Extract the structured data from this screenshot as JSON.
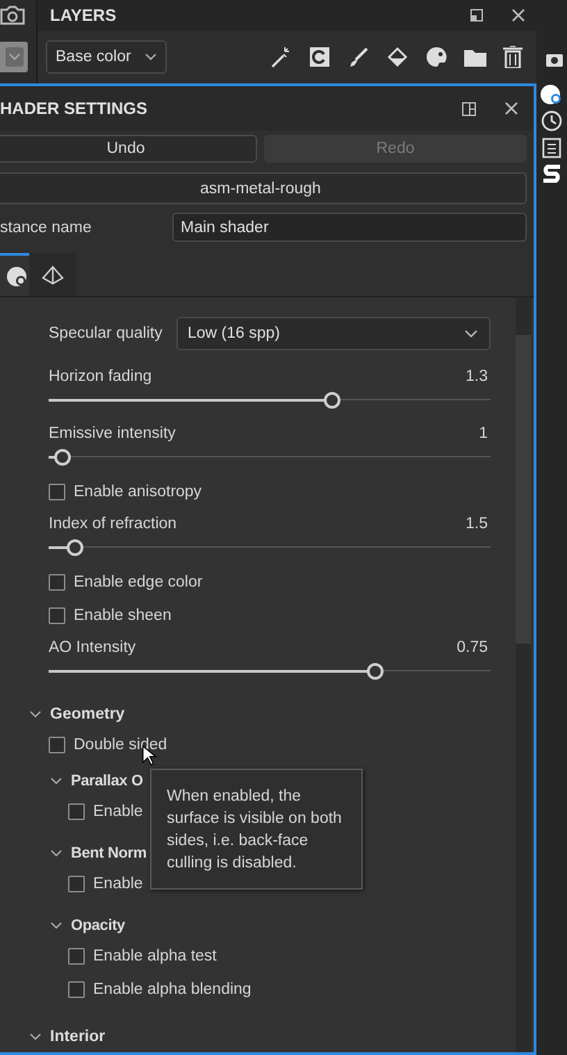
{
  "layers_panel": {
    "title": "LAYERS",
    "channel_dropdown": "Base color"
  },
  "shader_settings": {
    "title": "HADER SETTINGS",
    "undo": {
      "label": "Undo",
      "disabled": false
    },
    "redo": {
      "label": "Redo",
      "disabled": true
    },
    "shader_button": "asm-metal-rough",
    "instance_name": {
      "label": "stance name",
      "value": "Main shader"
    },
    "tabs": [
      {
        "selected": true
      },
      {
        "selected": false
      }
    ],
    "properties": [
      {
        "kind": "dropdown",
        "label": "Specular quality",
        "value": "Low (16 spp)"
      },
      {
        "kind": "slider",
        "label": "Horizon fading",
        "reading": "1.3",
        "level": 0.64
      },
      {
        "kind": "slider",
        "label": "Emissive intensity",
        "reading": "1",
        "level": 0.03
      },
      {
        "kind": "checkbox",
        "label": "Enable anisotropy",
        "checked": false
      },
      {
        "kind": "slider",
        "label": "Index of refraction",
        "reading": "1.5",
        "level": 0.06
      },
      {
        "kind": "checkbox",
        "label": "Enable edge color",
        "checked": false
      },
      {
        "kind": "checkbox",
        "label": "Enable sheen",
        "checked": false
      },
      {
        "kind": "slider",
        "label": "AO Intensity",
        "reading": "0.75",
        "level": 0.74
      }
    ],
    "sections": [
      {
        "title": "Geometry",
        "expanded": true,
        "items": [
          {
            "label": "Double sided",
            "checked": false
          }
        ],
        "children": [
          {
            "title": "Parallax O",
            "expanded": true,
            "items": [
              {
                "label": "Enable",
                "checked": false
              }
            ]
          },
          {
            "title": "Bent Norm",
            "expanded": true,
            "items": [
              {
                "label": "Enable",
                "checked": false
              }
            ]
          },
          {
            "title": "Opacity",
            "expanded": true,
            "items": [
              {
                "label": "Enable alpha test",
                "checked": false
              },
              {
                "label": "Enable alpha blending",
                "checked": false
              }
            ]
          }
        ]
      },
      {
        "title": "Interior",
        "expanded": true
      }
    ]
  },
  "tooltip": {
    "text": "When enabled, the surface is visible on both sides, i.e. back-face culling is disabled."
  }
}
